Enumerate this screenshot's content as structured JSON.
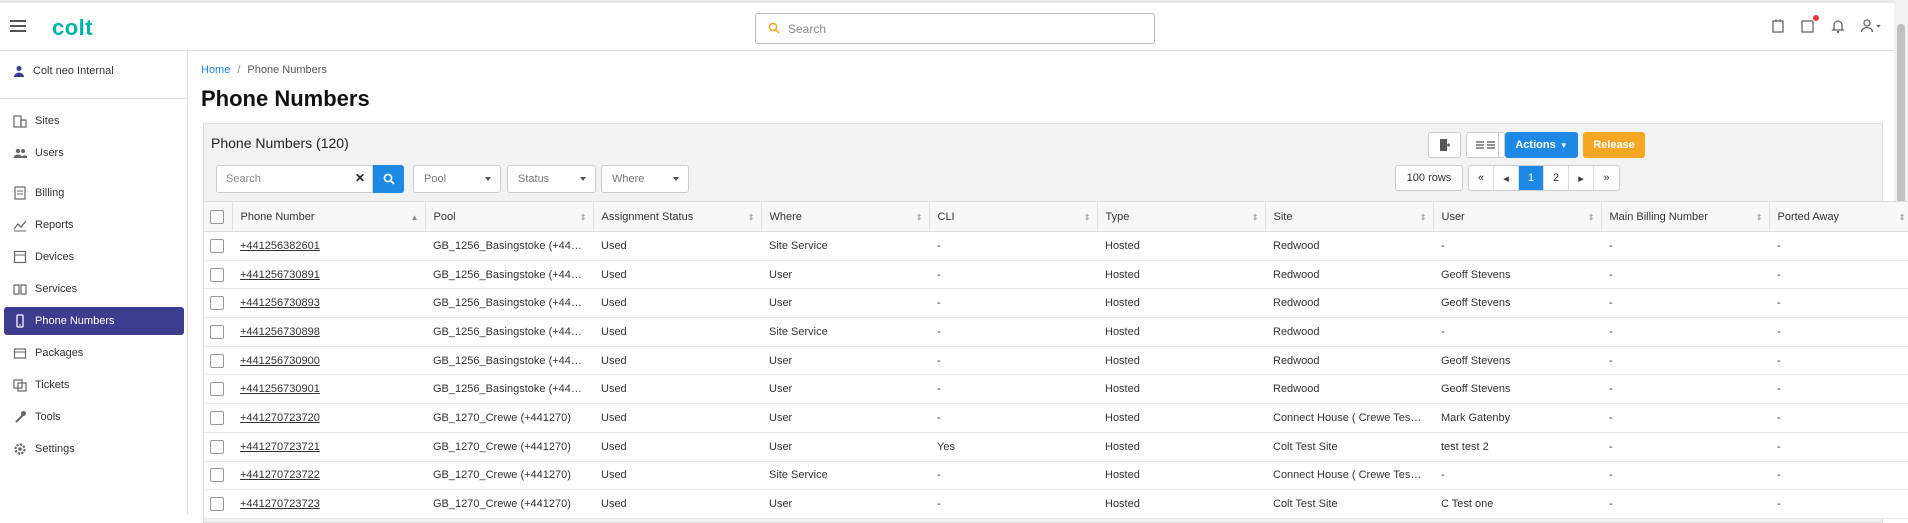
{
  "app": {
    "logo": "colt"
  },
  "header": {
    "search_placeholder": "Search"
  },
  "sidebar": {
    "user": "Colt neo Internal",
    "items": [
      {
        "label": "Sites",
        "icon": "sites-icon"
      },
      {
        "label": "Users",
        "icon": "users-icon"
      },
      {
        "label": "Billing",
        "icon": "billing-icon"
      },
      {
        "label": "Reports",
        "icon": "reports-icon"
      },
      {
        "label": "Devices",
        "icon": "devices-icon"
      },
      {
        "label": "Services",
        "icon": "services-icon"
      },
      {
        "label": "Phone Numbers",
        "icon": "phone-icon",
        "active": true
      },
      {
        "label": "Packages",
        "icon": "packages-icon"
      },
      {
        "label": "Tickets",
        "icon": "tickets-icon"
      },
      {
        "label": "Tools",
        "icon": "tools-icon"
      },
      {
        "label": "Settings",
        "icon": "settings-icon"
      }
    ]
  },
  "breadcrumb": {
    "home": "Home",
    "current": "Phone Numbers"
  },
  "page": {
    "title": "Phone Numbers"
  },
  "panel": {
    "title": "Phone Numbers (120)",
    "actions_label": "Actions",
    "release_label": "Release",
    "search_placeholder": "Search",
    "filters": {
      "pool": "Pool",
      "status": "Status",
      "where": "Where"
    },
    "rows_per_page": "100 rows",
    "pages": [
      "1",
      "2"
    ],
    "current_page": "1"
  },
  "table": {
    "columns": [
      "Phone Number",
      "Pool",
      "Assignment Status",
      "Where",
      "CLI",
      "Type",
      "Site",
      "User",
      "Main Billing Number",
      "Ported Away"
    ],
    "rows": [
      [
        "+441256382601",
        "GB_1256_Basingstoke (+44…",
        "Used",
        "Site Service",
        "-",
        "Hosted",
        "Redwood",
        "-",
        "-",
        "-"
      ],
      [
        "+441256730891",
        "GB_1256_Basingstoke (+44…",
        "Used",
        "User",
        "-",
        "Hosted",
        "Redwood",
        "Geoff Stevens",
        "-",
        "-"
      ],
      [
        "+441256730893",
        "GB_1256_Basingstoke (+44…",
        "Used",
        "User",
        "-",
        "Hosted",
        "Redwood",
        "Geoff Stevens",
        "-",
        "-"
      ],
      [
        "+441256730898",
        "GB_1256_Basingstoke (+44…",
        "Used",
        "Site Service",
        "-",
        "Hosted",
        "Redwood",
        "-",
        "-",
        "-"
      ],
      [
        "+441256730900",
        "GB_1256_Basingstoke (+44…",
        "Used",
        "User",
        "-",
        "Hosted",
        "Redwood",
        "Geoff Stevens",
        "-",
        "-"
      ],
      [
        "+441256730901",
        "GB_1256_Basingstoke (+44…",
        "Used",
        "User",
        "-",
        "Hosted",
        "Redwood",
        "Geoff Stevens",
        "-",
        "-"
      ],
      [
        "+441270723720",
        "GB_1270_Crewe (+441270)",
        "Used",
        "User",
        "-",
        "Hosted",
        "Connect House ( Crewe Tes…",
        "Mark Gatenby",
        "-",
        "-"
      ],
      [
        "+441270723721",
        "GB_1270_Crewe (+441270)",
        "Used",
        "User",
        "Yes",
        "Hosted",
        "Colt Test Site",
        "test test 2",
        "-",
        "-"
      ],
      [
        "+441270723722",
        "GB_1270_Crewe (+441270)",
        "Used",
        "Site Service",
        "-",
        "Hosted",
        "Connect House ( Crewe Tes…",
        "-",
        "-",
        "-"
      ],
      [
        "+441270723723",
        "GB_1270_Crewe (+441270)",
        "Used",
        "User",
        "-",
        "Hosted",
        "Colt Test Site",
        "C Test one",
        "-",
        "-"
      ]
    ]
  }
}
